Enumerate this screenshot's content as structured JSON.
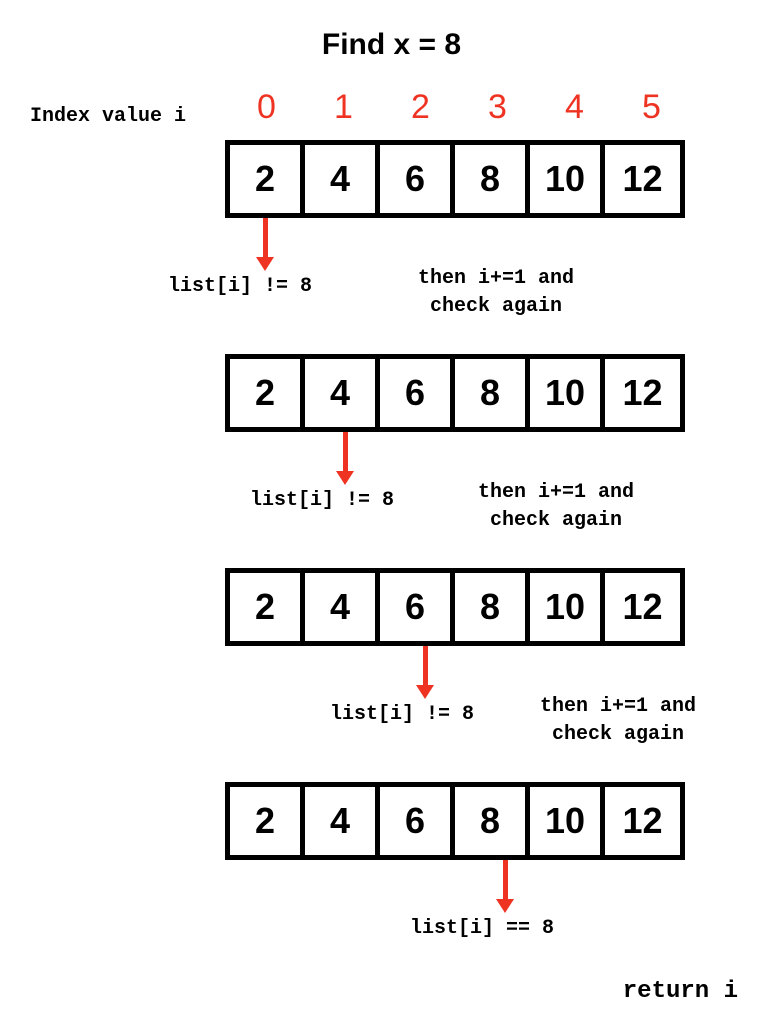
{
  "title": "Find x = 8",
  "index_label": "Index value i",
  "indices": [
    "0",
    "1",
    "2",
    "3",
    "4",
    "5"
  ],
  "array": [
    "2",
    "4",
    "6",
    "8",
    "10",
    "12"
  ],
  "steps": [
    {
      "arrow_cell": 0,
      "result": "list[i] != 8",
      "right_line1": "then i+=1 and",
      "right_line2": "check again"
    },
    {
      "arrow_cell": 1,
      "result": "list[i] != 8",
      "right_line1": "then i+=1 and",
      "right_line2": "check again"
    },
    {
      "arrow_cell": 2,
      "result": "list[i] != 8",
      "right_line1": "then i+=1 and",
      "right_line2": "check again"
    },
    {
      "arrow_cell": 3,
      "result": "list[i] == 8",
      "right_line1": "",
      "right_line2": ""
    }
  ],
  "return_text": "return i"
}
